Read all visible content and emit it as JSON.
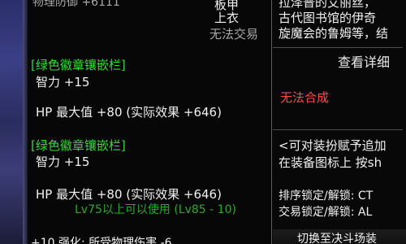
{
  "tooltip": {
    "top_partial_text": "物理防御 +6111",
    "right_info": {
      "line1": "板甲",
      "line2": "上衣",
      "line3": "无法交易"
    },
    "slot1": {
      "header": "[绿色徽章镶嵌栏]",
      "stat1": "智力 +15",
      "stat2": "HP 最大值 +80 (实际效果 +646)"
    },
    "slot2": {
      "header": "[绿色徽章镶嵌栏]",
      "stat1": "智力 +15",
      "stat2": "HP 最大值 +80 (实际效果 +646)"
    },
    "usable_level": "Lv75以上可以使用 (Lv85 - 10)",
    "bottom_partial": "+10 强化: 所受物理伤害 -6"
  },
  "right_panel": {
    "desc1": "拉泽普的艾丽丝，",
    "desc2": "古代图书馆的伊奇",
    "desc3": "旋魔会的鲁姆等，结",
    "view_detail": "查看详细",
    "cannot_synthesize": "无法合成",
    "dressup_line1": "<可对装扮赋予追加",
    "dressup_line2": "在装备图标上 按sh",
    "lock1": "排序锁定/解锁: CT",
    "lock2": "交易锁定/解锁: AL",
    "bottom_button": "切换至决斗场装"
  },
  "colors": {
    "green": "#3bd43b",
    "red": "#ff4a4a",
    "white": "#f1f1f1",
    "gray": "#a8a8a8"
  }
}
